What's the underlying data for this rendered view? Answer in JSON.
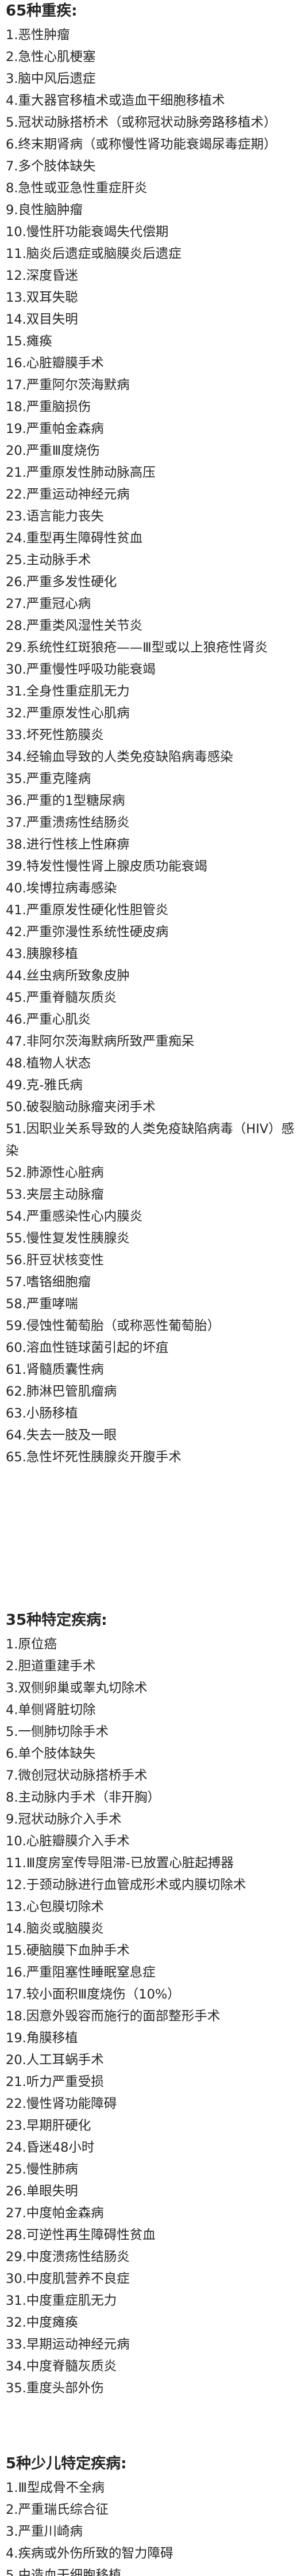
{
  "sections": [
    {
      "id": "sec-65",
      "title": "65种重疾:",
      "items": [
        "1.恶性肿瘤",
        "2.急性心肌梗塞",
        "3.脑中风后遗症",
        "4.重大器官移植术或造血干细胞移植术",
        "5.冠状动脉搭桥术（或称冠状动脉旁路移植术）",
        "6.终末期肾病（或称慢性肾功能衰竭尿毒症期）",
        "7.多个肢体缺失",
        "8.急性或亚急性重症肝炎",
        "9.良性脑肿瘤",
        "10.慢性肝功能衰竭失代偿期",
        "11.脑炎后遗症或脑膜炎后遗症",
        "12.深度昏迷",
        "13.双耳失聪",
        "14.双目失明",
        "15.瘫痪",
        "16.心脏瓣膜手术",
        "17.严重阿尔茨海默病",
        "18.严重脑损伤",
        "19.严重帕金森病",
        "20.严重Ⅲ度烧伤",
        "21.严重原发性肺动脉高压",
        "22.严重运动神经元病",
        "23.语言能力丧失",
        "24.重型再生障碍性贫血",
        "25.主动脉手术",
        "26.严重多发性硬化",
        "27.严重冠心病",
        "28.严重类风湿性关节炎",
        "29.系统性红斑狼疮——Ⅲ型或以上狼疮性肾炎",
        "30.严重慢性呼吸功能衰竭",
        "31.全身性重症肌无力",
        "32.严重原发性心肌病",
        "33.坏死性筋膜炎",
        "34.经输血导致的人类免疫缺陷病毒感染",
        "35.严重克隆病",
        "36.严重的1型糖尿病",
        "37.严重溃疡性结肠炎",
        "38.进行性核上性麻痹",
        "39.特发性慢性肾上腺皮质功能衰竭",
        "40.埃博拉病毒感染",
        "41.严重原发性硬化性胆管炎",
        "42.严重弥漫性系统性硬皮病",
        "43.胰腺移植",
        "44.丝虫病所致象皮肿",
        "45.严重脊髓灰质炎",
        "46.严重心肌炎",
        "47.非阿尔茨海默病所致严重痴呆",
        "48.植物人状态",
        "49.克-雅氏病",
        "50.破裂脑动脉瘤夹闭手术",
        "51.因职业关系导致的人类免疫缺陷病毒（HIV）感染",
        "52.肺源性心脏病",
        "53.夹层主动脉瘤",
        "54.严重感染性心内膜炎",
        "55.慢性复发性胰腺炎",
        "56.肝豆状核变性",
        "57.嗜铬细胞瘤",
        "58.严重哮喘",
        "59.侵蚀性葡萄胎（或称恶性葡萄胎）",
        "60.溶血性链球菌引起的坏疽",
        "61.肾髓质囊性病",
        "62.肺淋巴管肌瘤病",
        "63.小肠移植",
        "64.失去一肢及一眼",
        "65.急性坏死性胰腺炎开腹手术"
      ]
    },
    {
      "id": "sec-35",
      "title": "35种特定疾病:",
      "items": [
        "1.原位癌",
        "2.胆道重建手术",
        "3.双侧卵巢或睾丸切除术",
        "4.单侧肾脏切除",
        "5.一侧肺切除手术",
        "6.单个肢体缺失",
        "7.微创冠状动脉搭桥手术",
        "8.主动脉内手术（非开胸）",
        "9.冠状动脉介入手术",
        "10.心脏瓣膜介入手术",
        "11.Ⅲ度房室传导阻滞-已放置心脏起搏器",
        "12.于颈动脉进行血管成形术或内膜切除术",
        "13.心包膜切除术",
        "14.脑炎或脑膜炎",
        "15.硬脑膜下血肿手术",
        "16.严重阻塞性睡眠窒息症",
        "17.较小面积Ⅲ度烧伤（10%）",
        "18.因意外毁容而施行的面部整形手术",
        "19.角膜移植",
        "20.人工耳蜗手术",
        "21.听力严重受损",
        "22.慢性肾功能障碍",
        "23.早期肝硬化",
        "24.昏迷48小时",
        "25.慢性肺病",
        "26.单眼失明",
        "27.中度帕金森病",
        "28.可逆性再生障碍性贫血",
        "29.中度溃疡性结肠炎",
        "30.中度肌营养不良症",
        "31.中度重症肌无力",
        "32.中度瘫痪",
        "33.早期运动神经元病",
        "34.中度脊髓灰质炎",
        "35.重度头部外伤"
      ]
    },
    {
      "id": "sec-5",
      "title": "5种少儿特定疾病:",
      "items": [
        "1.Ⅲ型成骨不全病",
        "2.严重瑞氏综合征",
        "3.严重川崎病",
        "4.疾病或外伤所致的智力障碍",
        "5.由造血干细胞移植"
      ]
    }
  ]
}
